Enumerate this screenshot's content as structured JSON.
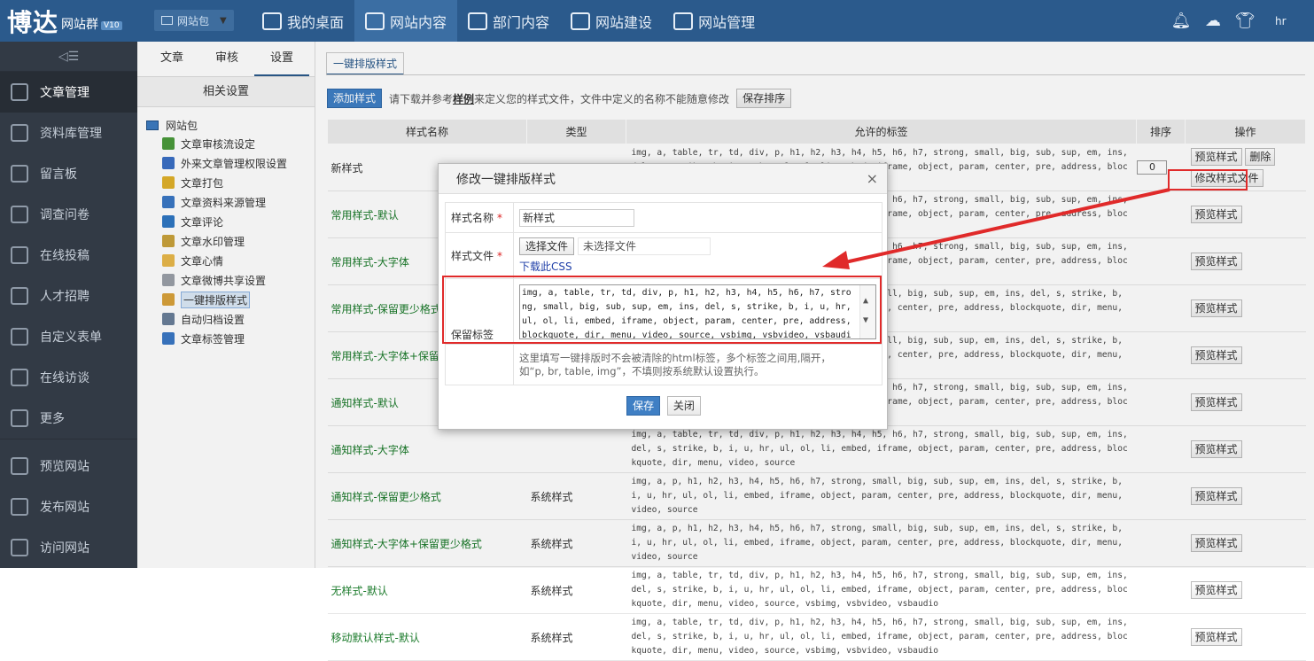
{
  "app": {
    "logo_main": "博达",
    "logo_sub": "网站群",
    "logo_version": "V10",
    "site_selector": "网站包",
    "nav": [
      {
        "label": "我的桌面",
        "active": false
      },
      {
        "label": "网站内容",
        "active": true
      },
      {
        "label": "部门内容",
        "active": false
      },
      {
        "label": "网站建设",
        "active": false
      },
      {
        "label": "网站管理",
        "active": false
      }
    ],
    "user": "hr"
  },
  "sidebar": {
    "toggle": "◁☰",
    "items": [
      {
        "label": "文章管理",
        "active": true
      },
      {
        "label": "资料库管理"
      },
      {
        "label": "留言板"
      },
      {
        "label": "调查问卷"
      },
      {
        "label": "在线投稿"
      },
      {
        "label": "人才招聘"
      },
      {
        "label": "自定义表单"
      },
      {
        "label": "在线访谈"
      },
      {
        "label": "更多"
      }
    ],
    "bottom_items": [
      {
        "label": "预览网站"
      },
      {
        "label": "发布网站"
      },
      {
        "label": "访问网站"
      }
    ]
  },
  "subpanel": {
    "tabs": [
      {
        "label": "文章"
      },
      {
        "label": "审核"
      },
      {
        "label": "设置",
        "active": true
      }
    ],
    "heading": "相关设置",
    "root": "网站包",
    "nodes": [
      {
        "label": "文章审核流设定",
        "color": "#4a9a3c"
      },
      {
        "label": "外来文章管理权限设置",
        "color": "#3a6fc4"
      },
      {
        "label": "文章打包",
        "color": "#e0b02a"
      },
      {
        "label": "文章资料来源管理",
        "color": "#3a78c4"
      },
      {
        "label": "文章评论",
        "color": "#2f76c2"
      },
      {
        "label": "文章水印管理",
        "color": "#c9a23b"
      },
      {
        "label": "文章心情",
        "color": "#e8b84a"
      },
      {
        "label": "文章微博共享设置",
        "color": "#9aa0a8"
      },
      {
        "label": "一键排版样式",
        "color": "#d9a23a",
        "selected": true
      },
      {
        "label": "自动归档设置",
        "color": "#6a7f99"
      },
      {
        "label": "文章标签管理",
        "color": "#3a78c4"
      }
    ]
  },
  "content": {
    "tab": "一键排版样式",
    "add_button": "添加样式",
    "hint_pre": "请下载并参考",
    "hint_link": "样例",
    "hint_post": "来定义您的样式文件，文件中定义的名称不能随意修改",
    "save_order_button": "保存排序",
    "columns": [
      "样式名称",
      "类型",
      "允许的标签",
      "排序",
      "操作"
    ],
    "rows": [
      {
        "name": "新样式",
        "type": "",
        "tags": "img, a, table, tr, td, div, p, h1, h2, h3, h4, h5, h6, h7, strong, small, big, sub, sup, em, ins, del, s, strike, b, i, u, hr, ul, ol, li, embed, iframe, object, param, center, pre, address, blockquote, dir, menu, video, source",
        "order": "0",
        "preview": "预览样式",
        "delete": "删除",
        "modify": "修改样式文件"
      },
      {
        "name": "常用样式-默认",
        "type": "",
        "tags": "img, a, table, tr, td, div, p, h1, h2, h3, h4, h5, h6, h7, strong, small, big, sub, sup, em, ins, del, s, strike, b, i, u, hr, ul, ol, li, embed, iframe, object, param, center, pre, address, blockquote, dir, menu, video, source",
        "preview": "预览样式"
      },
      {
        "name": "常用样式-大字体",
        "type": "",
        "tags": "img, a, table, tr, td, div, p, h1, h2, h3, h4, h5, h6, h7, strong, small, big, sub, sup, em, ins, del, s, strike, b, i, u, hr, ul, ol, li, embed, iframe, object, param, center, pre, address, blockquote, dir, menu, video, source",
        "preview": "预览样式"
      },
      {
        "name": "常用样式-保留更少格式",
        "type": "",
        "tags": "img, a, p, h1, h2, h3, h4, h5, h6, h7, strong, small, big, sub, sup, em, ins, del, s, strike, b, i, u, hr, ul, ol, li, embed, iframe, object, param, center, pre, address, blockquote, dir, menu, video, source",
        "preview": "预览样式"
      },
      {
        "name": "常用样式-大字体+保留更少格式",
        "type": "",
        "tags": "img, a, p, h1, h2, h3, h4, h5, h6, h7, strong, small, big, sub, sup, em, ins, del, s, strike, b, i, u, hr, ul, ol, li, embed, iframe, object, param, center, pre, address, blockquote, dir, menu, video, source",
        "preview": "预览样式"
      },
      {
        "name": "通知样式-默认",
        "type": "",
        "tags": "img, a, table, tr, td, div, p, h1, h2, h3, h4, h5, h6, h7, strong, small, big, sub, sup, em, ins, del, s, strike, b, i, u, hr, ul, ol, li, embed, iframe, object, param, center, pre, address, blockquote, dir, menu, video, source",
        "preview": "预览样式"
      },
      {
        "name": "通知样式-大字体",
        "type": "",
        "tags": "img, a, table, tr, td, div, p, h1, h2, h3, h4, h5, h6, h7, strong, small, big, sub, sup, em, ins, del, s, strike, b, i, u, hr, ul, ol, li, embed, iframe, object, param, center, pre, address, blockquote, dir, menu, video, source",
        "preview": "预览样式"
      },
      {
        "name": "通知样式-保留更少格式",
        "type": "系统样式",
        "tags": "img, a, p, h1, h2, h3, h4, h5, h6, h7, strong, small, big, sub, sup, em, ins, del, s, strike, b, i, u, hr, ul, ol, li, embed, iframe, object, param, center, pre, address, blockquote, dir, menu, video, source",
        "preview": "预览样式"
      },
      {
        "name": "通知样式-大字体+保留更少格式",
        "type": "系统样式",
        "tags": "img, a, p, h1, h2, h3, h4, h5, h6, h7, strong, small, big, sub, sup, em, ins, del, s, strike, b, i, u, hr, ul, ol, li, embed, iframe, object, param, center, pre, address, blockquote, dir, menu, video, source",
        "preview": "预览样式"
      },
      {
        "name": "无样式-默认",
        "type": "系统样式",
        "tags": "img, a, table, tr, td, div, p, h1, h2, h3, h4, h5, h6, h7, strong, small, big, sub, sup, em, ins, del, s, strike, b, i, u, hr, ul, ol, li, embed, iframe, object, param, center, pre, address, blockquote, dir, menu, video, source, vsbimg, vsbvideo, vsbaudio",
        "preview": "预览样式"
      },
      {
        "name": "移动默认样式-默认",
        "type": "系统样式",
        "tags": "img, a, table, tr, td, div, p, h1, h2, h3, h4, h5, h6, h7, strong, small, big, sub, sup, em, ins, del, s, strike, b, i, u, hr, ul, ol, li, embed, iframe, object, param, center, pre, address, blockquote, dir, menu, video, source, vsbimg, vsbvideo, vsbaudio",
        "preview": "预览样式"
      }
    ]
  },
  "dialog": {
    "title": "修改一键排版样式",
    "close": "×",
    "name_label": "样式名称",
    "name_value": "新样式",
    "file_label": "样式文件",
    "file_button": "选择文件",
    "file_value": "未选择文件",
    "download_link": "下载此CSS",
    "keep_label": "保留标签",
    "keep_value": "img, a, table, tr, td, div, p, h1, h2, h3, h4, h5, h6, h7, strong, small, big, sub, sup, em, ins, del, s, strike, b, i, u, hr, ul, ol, li, embed, iframe, object, param, center, pre, address, blockquote, dir, menu, video, source, vsbimg, vsbvideo, vsbaudio",
    "help_line1": "这里填写一键排版时不会被清除的html标签，多个标签之间用,隔开，",
    "help_line2": "如“p, br, table, img”，不填则按系统默认设置执行。",
    "save": "保存",
    "cancel": "关闭"
  },
  "colors": {
    "header": "#2b5a8c",
    "sidebar": "#323a45",
    "highlight": "#e02a2a",
    "accent": "#3f7fc4"
  }
}
